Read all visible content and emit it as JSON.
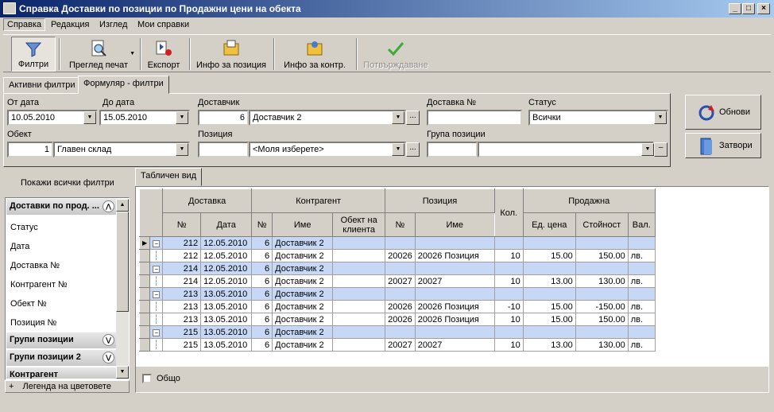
{
  "window": {
    "title": "Справка Доставки по позиции по Продажни цени на обекта",
    "min": "_",
    "max": "□",
    "close": "×"
  },
  "menu": [
    "Справка",
    "Редакция",
    "Изглед",
    "Мои справки"
  ],
  "toolbar": {
    "filters": "Филтри",
    "preview": "Преглед печат",
    "export": "Експорт",
    "info_position": "Инфо за позиция",
    "info_contr": "Инфо за контр.",
    "confirm": "Потвърждаване"
  },
  "filter_tabs": [
    "Активни филтри",
    "Формуляр - филтри"
  ],
  "filters": {
    "from_date": {
      "label": "От дата",
      "value": "10.05.2010"
    },
    "to_date": {
      "label": "До дата",
      "value": "15.05.2010"
    },
    "supplier": {
      "label": "Доставчик",
      "code": "6",
      "name": "Доставчик 2"
    },
    "delivery_no": {
      "label": "Доставка №",
      "value": ""
    },
    "status": {
      "label": "Статус",
      "value": "Всички"
    },
    "object": {
      "label": "Обект",
      "code": "1",
      "name": "Главен склад"
    },
    "position": {
      "label": "Позиция",
      "code": "",
      "name": "<Моля изберете>"
    },
    "position_group": {
      "label": "Група позиции",
      "code": "",
      "name": ""
    }
  },
  "buttons": {
    "refresh": "Обнови",
    "close": "Затвори"
  },
  "left": {
    "show_all": "Покажи всички филтри",
    "group_main": "Доставки по прод. ...",
    "items": [
      "Статус",
      "Дата",
      "Доставка №",
      "Контрагент №",
      "Обект №",
      "Позиция №"
    ],
    "groups": [
      "Групи позиции",
      "Групи позиции 2",
      "Контрагент"
    ],
    "legend": "Легенда на цветовете"
  },
  "grid_tab": "Табличен вид",
  "grid": {
    "groups": {
      "delivery": "Доставка",
      "contragent": "Контрагент",
      "position": "Позиция",
      "qty": "Кол.",
      "sale": "Продажна"
    },
    "cols": {
      "no": "№",
      "date": "Дата",
      "cno": "№",
      "name": "Име",
      "obj": "Обект на клиента",
      "pno": "№",
      "pname": "Име",
      "price": "Ед. цена",
      "value": "Стойност",
      "cur": "Вал."
    },
    "rows": [
      {
        "type": "master",
        "no": "212",
        "date": "12.05.2010",
        "cno": "6",
        "cname": "Доставчик 2",
        "pno": "",
        "pname": "",
        "qty": "",
        "price": "",
        "value": "",
        "cur": ""
      },
      {
        "type": "detail",
        "no": "212",
        "date": "12.05.2010",
        "cno": "6",
        "cname": "Доставчик 2",
        "pno": "20026",
        "pname": "20026 Позиция",
        "qty": "10",
        "price": "15.00",
        "value": "150.00",
        "cur": "лв."
      },
      {
        "type": "master",
        "no": "214",
        "date": "12.05.2010",
        "cno": "6",
        "cname": "Доставчик 2",
        "pno": "",
        "pname": "",
        "qty": "",
        "price": "",
        "value": "",
        "cur": ""
      },
      {
        "type": "detail",
        "no": "214",
        "date": "12.05.2010",
        "cno": "6",
        "cname": "Доставчик 2",
        "pno": "20027",
        "pname": "20027",
        "qty": "10",
        "price": "13.00",
        "value": "130.00",
        "cur": "лв."
      },
      {
        "type": "master",
        "no": "213",
        "date": "13.05.2010",
        "cno": "6",
        "cname": "Доставчик 2",
        "pno": "",
        "pname": "",
        "qty": "",
        "price": "",
        "value": "",
        "cur": ""
      },
      {
        "type": "detail",
        "no": "213",
        "date": "13.05.2010",
        "cno": "6",
        "cname": "Доставчик 2",
        "pno": "20026",
        "pname": "20026 Позиция",
        "qty": "-10",
        "price": "15.00",
        "value": "-150.00",
        "cur": "лв."
      },
      {
        "type": "detail",
        "no": "213",
        "date": "13.05.2010",
        "cno": "6",
        "cname": "Доставчик 2",
        "pno": "20026",
        "pname": "20026 Позиция",
        "qty": "10",
        "price": "15.00",
        "value": "150.00",
        "cur": "лв."
      },
      {
        "type": "master",
        "no": "215",
        "date": "13.05.2010",
        "cno": "6",
        "cname": "Доставчик 2",
        "pno": "",
        "pname": "",
        "qty": "",
        "price": "",
        "value": "",
        "cur": ""
      },
      {
        "type": "detail",
        "no": "215",
        "date": "13.05.2010",
        "cno": "6",
        "cname": "Доставчик 2",
        "pno": "20027",
        "pname": "20027",
        "qty": "10",
        "price": "13.00",
        "value": "130.00",
        "cur": "лв."
      }
    ]
  },
  "total_label": "Общо"
}
